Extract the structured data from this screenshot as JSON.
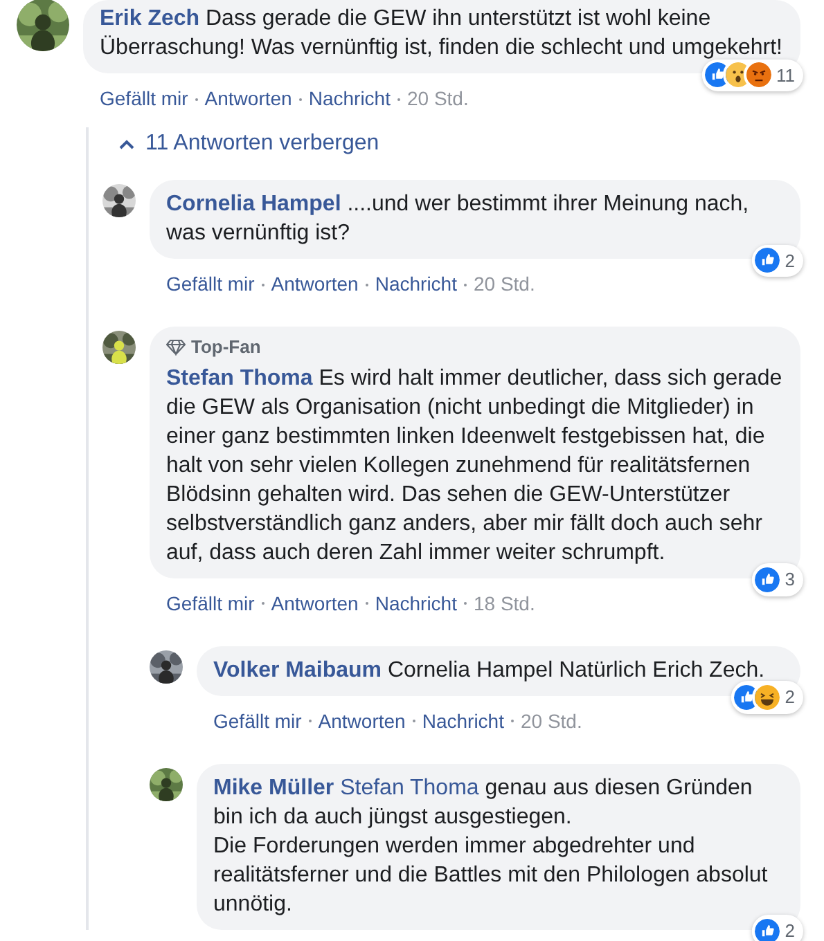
{
  "comments": [
    {
      "author": "Erik Zech",
      "text": "Dass gerade die GEW ihn unterstützt ist wohl keine Überraschung! Was vernünftig ist, finden die schlecht und umgekehrt!",
      "reactions": {
        "kinds": [
          {
            "kind": "like"
          },
          {
            "kind": "wow"
          },
          {
            "kind": "angry"
          }
        ],
        "count": "11"
      },
      "actions": [
        "Gefällt mir",
        "Antworten",
        "Nachricht"
      ],
      "time": "20 Std.",
      "replies_toggle": "11 Antworten verbergen",
      "replies": [
        {
          "author": "Cornelia Hampel",
          "text": "....und wer bestimmt ihrer Meinung nach, was vernünftig ist?",
          "reactions": {
            "kinds": [
              {
                "kind": "like"
              }
            ],
            "count": "2"
          },
          "actions": [
            "Gefällt mir",
            "Antworten",
            "Nachricht"
          ],
          "time": "20 Std."
        },
        {
          "author": "Stefan Thoma",
          "badge": "Top-Fan",
          "text": "Es wird halt immer deutlicher, dass sich gerade die GEW als Organisation (nicht unbedingt die Mitglieder) in einer ganz bestimmten linken Ideenwelt festgebissen hat, die halt von sehr vielen Kollegen zunehmend für realitätsfernen Blödsinn gehalten wird. Das sehen die GEW-Unterstützer selbstverständlich ganz anders, aber mir fällt doch auch sehr auf, dass auch deren Zahl immer weiter schrumpft.",
          "reactions": {
            "kinds": [
              {
                "kind": "like"
              }
            ],
            "count": "3"
          },
          "actions": [
            "Gefällt mir",
            "Antworten",
            "Nachricht"
          ],
          "time": "18 Std.",
          "replies": [
            {
              "author": "Volker Maibaum",
              "text": "Cornelia Hampel Natürlich Erich Zech.",
              "reactions": {
                "kinds": [
                  {
                    "kind": "like"
                  },
                  {
                    "kind": "haha"
                  }
                ],
                "count": "2"
              },
              "actions": [
                "Gefällt mir",
                "Antworten",
                "Nachricht"
              ],
              "time": "20 Std."
            },
            {
              "author": "Mike Müller",
              "mention": "Stefan Thoma",
              "text": "genau aus diesen Gründen bin ich da auch jüngst ausgestiegen.\nDie Forderungen werden immer abgedrehter und realitätsferner und die Battles mit den Philologen absolut unnötig.",
              "reactions": {
                "kinds": [
                  {
                    "kind": "like"
                  }
                ],
                "count": "2"
              }
            }
          ]
        }
      ]
    }
  ]
}
